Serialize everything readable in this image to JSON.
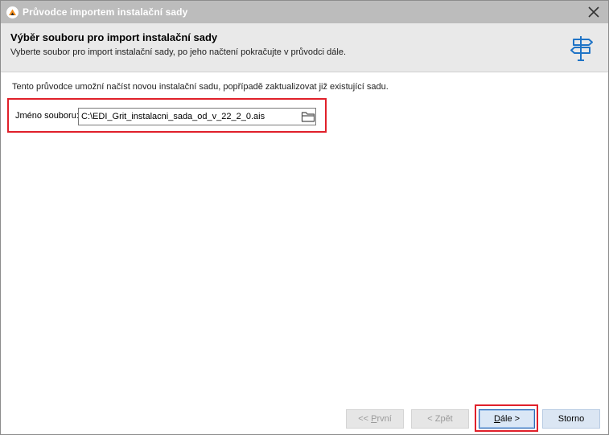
{
  "window": {
    "title": "Průvodce importem instalační sady"
  },
  "header": {
    "title": "Výběr souboru pro import instalační sady",
    "subtitle": "Vyberte soubor pro import instalační sady, po jeho načtení pokračujte v průvodci dále.",
    "icon": "signpost-icon"
  },
  "main": {
    "intro": "Tento průvodce umožní načíst novou instalační sadu, popřípadě zaktualizovat již existující sadu.",
    "file": {
      "label": "Jméno souboru:",
      "value": "C:\\EDI_Grit_instalacni_sada_od_v_22_2_0.ais",
      "browse_icon": "folder-icon"
    }
  },
  "footer": {
    "buttons": {
      "first": {
        "prefix": "<< ",
        "mnemonic": "P",
        "rest": "rvní",
        "enabled": false
      },
      "back": {
        "label": "< Zpět",
        "enabled": false
      },
      "next": {
        "mnemonic": "D",
        "rest": "ále >",
        "enabled": true
      },
      "cancel": {
        "label": "Storno",
        "enabled": true
      }
    }
  },
  "colors": {
    "titlebar": "#bcbcbc",
    "header": "#e9e9e9",
    "highlight": "#e0202a",
    "primary_border": "#2d6bb5"
  }
}
